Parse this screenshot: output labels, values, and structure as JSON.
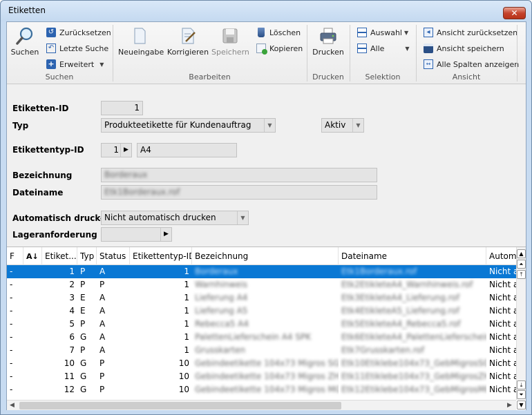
{
  "window": {
    "title": "Etiketten",
    "close": "✕"
  },
  "ribbon": {
    "suchen_group": {
      "label": "Suchen",
      "search": "Suchen",
      "reset": "Zurücksetzen",
      "last_search": "Letzte Suche",
      "extended": "Erweitert"
    },
    "bearbeiten_group": {
      "label": "Bearbeiten",
      "new_entry": "Neueingabe",
      "correct": "Korrigieren",
      "save": "Speichern",
      "delete": "Löschen",
      "copy": "Kopieren"
    },
    "drucken_group": {
      "label": "Drucken",
      "print": "Drucken"
    },
    "selektion_group": {
      "label": "Selektion",
      "selection": "Auswahl",
      "all": "Alle"
    },
    "ansicht_group": {
      "label": "Ansicht",
      "reset_view": "Ansicht zurücksetzen",
      "save_view": "Ansicht speichern",
      "show_all_columns": "Alle Spalten anzeigen"
    }
  },
  "form": {
    "etiketten_id": {
      "label": "Etiketten-ID",
      "value": "1"
    },
    "typ": {
      "label": "Typ",
      "value": "Produkteetikette für Kundenauftrag",
      "status": "Aktiv"
    },
    "etikettentyp_id": {
      "label": "Etikettentyp-ID",
      "value": "1",
      "name": "A4"
    },
    "bezeichnung": {
      "label": "Bezeichnung",
      "value": "Borderaux"
    },
    "dateiname": {
      "label": "Dateiname",
      "value": "Etk1Borderaux.rof"
    },
    "automatisch_drucken": {
      "label": "Automatisch drucken",
      "value": "Nicht automatisch drucken"
    },
    "lageranforderung": {
      "label": "Lageranforderung",
      "value": ""
    }
  },
  "grid": {
    "headers": [
      "F",
      "",
      "Etiket...",
      "Typ",
      "Status",
      "Etikettentyp-ID",
      "Bezeichnung",
      "Dateiname",
      "Automa"
    ],
    "rows": [
      {
        "f": "-",
        "id": "1",
        "typ": "P",
        "status": "A",
        "typ_id": "1",
        "bez": "Borderaux",
        "datei": "Etk1Borderaux.rof",
        "auto": "Nicht a"
      },
      {
        "f": "-",
        "id": "2",
        "typ": "P",
        "status": "P",
        "typ_id": "1",
        "bez": "Warnhinweis",
        "datei": "Etk2EtikleteA4_Warnhinweis.rof",
        "auto": "Nicht a"
      },
      {
        "f": "-",
        "id": "3",
        "typ": "E",
        "status": "A",
        "typ_id": "1",
        "bez": "Lieferung A4",
        "datei": "Etk3EtikleteA4_Lieferung.rof",
        "auto": "Nicht a"
      },
      {
        "f": "-",
        "id": "4",
        "typ": "E",
        "status": "A",
        "typ_id": "1",
        "bez": "Lieferung A5",
        "datei": "Etk4EtikleteA5_Lieferung.rof",
        "auto": "Nicht a"
      },
      {
        "f": "-",
        "id": "5",
        "typ": "P",
        "status": "A",
        "typ_id": "1",
        "bez": "Rebecca5 A4",
        "datei": "Etk5EtikleteA4_Rebecca5.rof",
        "auto": "Nicht a"
      },
      {
        "f": "-",
        "id": "6",
        "typ": "G",
        "status": "A",
        "typ_id": "1",
        "bez": "PalettenLieferschein A4 SPK",
        "datei": "Etk6EtikleteA4_PalettenLieferschein.rof",
        "auto": "Nicht a"
      },
      {
        "f": "-",
        "id": "7",
        "typ": "P",
        "status": "A",
        "typ_id": "1",
        "bez": "Grusskarten",
        "datei": "Etk7Grusskarten.rof",
        "auto": "Nicht a"
      },
      {
        "f": "-",
        "id": "10",
        "typ": "G",
        "status": "P",
        "typ_id": "10",
        "bez": "Gebindeetikette 104x73 Migros SG",
        "datei": "Etk10Etiklebe104x73_GebMigrosSG.rof",
        "auto": "Nicht a"
      },
      {
        "f": "-",
        "id": "11",
        "typ": "G",
        "status": "P",
        "typ_id": "10",
        "bez": "Gebindeetikette 104x73 Migros ZH",
        "datei": "Etk11Etiklebe104x73_GebMigrosZH.rof",
        "auto": "Nicht a"
      },
      {
        "f": "-",
        "id": "12",
        "typ": "G",
        "status": "P",
        "typ_id": "10",
        "bez": "Gebindeetikette 104x73 Migros MGB",
        "datei": "Etk12Etiklebe104x73_GebMigrosMGB.rof",
        "auto": "Nicht a"
      }
    ]
  },
  "colors": {
    "selection": "#0a78d4",
    "title_bg": "#c7dbf1",
    "close_red": "#c5442e"
  },
  "icons": [
    "search-icon",
    "reset-icon",
    "last-search-icon",
    "extended-search-icon",
    "new-entry-icon",
    "correct-icon",
    "save-icon",
    "delete-icon",
    "copy-icon",
    "printer-icon",
    "selection-icon",
    "all-icon",
    "reset-view-icon",
    "save-view-icon",
    "show-columns-icon",
    "sort-icon"
  ]
}
